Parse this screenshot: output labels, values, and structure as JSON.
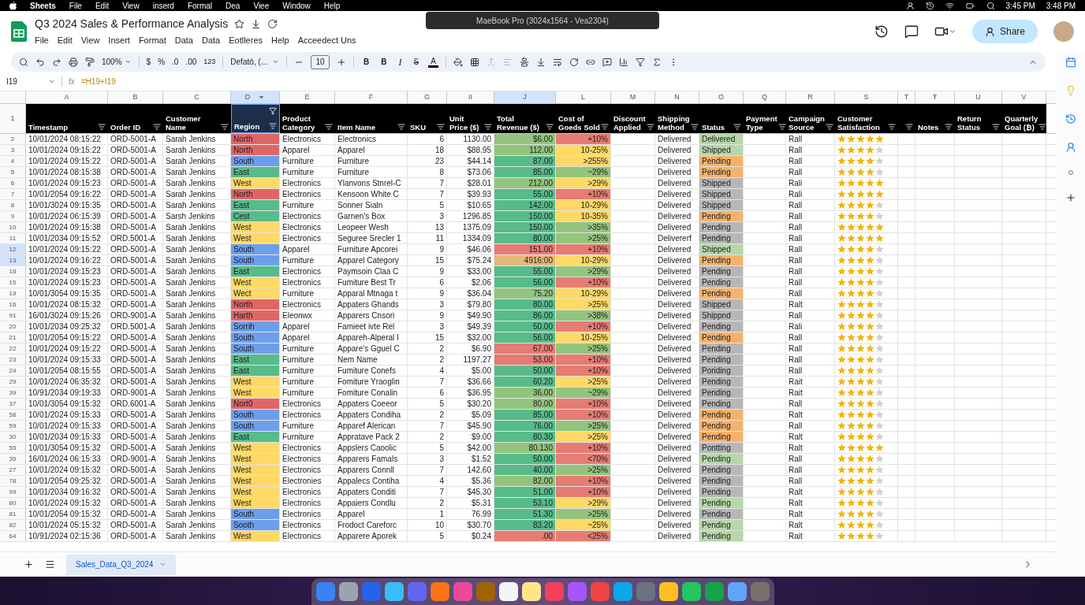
{
  "menubar": {
    "app": "Sheets",
    "items": [
      "File",
      "Edit",
      "View",
      "inserd",
      "Formal",
      "Dea",
      "Viee",
      "Window",
      "Help"
    ],
    "times": [
      "3:45 PM",
      "3:48 PM"
    ]
  },
  "tooltip": "MaeBook Pro (3024x1564 - Vea2304)",
  "doc": {
    "title": "Q3 2024 Sales & Performance Analysis",
    "menus": [
      "File",
      "Edit",
      "View",
      "Insert",
      "Format",
      "Data",
      "Data",
      "Eotlleres",
      "Help",
      "Acceedect Uns"
    ],
    "share": "Share"
  },
  "toolbar": {
    "zoom": "100%",
    "currency": "$",
    "percent": "%",
    "decrease_decimal": ".0",
    "increase_decimal": ".00",
    "number_format": "123",
    "font": "Defató, (...",
    "font_size": "10",
    "bold": "B",
    "bold_2": "B",
    "italic": "I",
    "strikethrough": "S",
    "text_color": "A"
  },
  "formula_bar": {
    "cell": "I19",
    "fx_label": "fx",
    "formula": "=H19+I19"
  },
  "header_row_number": "1",
  "columns": [
    {
      "letter": "A",
      "header": "Timestamp",
      "selected": false,
      "filter_active": false
    },
    {
      "letter": "B",
      "header": "Order ID",
      "selected": false,
      "filter_active": false
    },
    {
      "letter": "C",
      "header": "Customer Name",
      "selected": false,
      "filter_active": false
    },
    {
      "letter": "D",
      "header": "Region",
      "selected": true,
      "filter_active": true
    },
    {
      "letter": "E",
      "header": "Product Category",
      "selected": false,
      "filter_active": false
    },
    {
      "letter": "F",
      "header": "Item Name",
      "selected": false,
      "filter_active": false
    },
    {
      "letter": "G",
      "header": "SKU",
      "selected": false,
      "filter_active": false
    },
    {
      "letter": "II",
      "header": "Unit Price ($)",
      "selected": false,
      "filter_active": false
    },
    {
      "letter": "J",
      "header": "Total Revenue ($)",
      "selected": true,
      "filter_active": false
    },
    {
      "letter": "L",
      "header": "Cost of Goeds Sold",
      "selected": false,
      "filter_active": false
    },
    {
      "letter": "M",
      "header": "Discount Applied",
      "selected": false,
      "filter_active": false
    },
    {
      "letter": "N",
      "header": "Shipping Method",
      "selected": false,
      "filter_active": false
    },
    {
      "letter": "O",
      "header": "Status",
      "selected": false,
      "filter_active": false
    },
    {
      "letter": "Q",
      "header": "Payment Type",
      "selected": false,
      "filter_active": false
    },
    {
      "letter": "R",
      "header": "Campaign Source",
      "selected": false,
      "filter_active": false
    },
    {
      "letter": "S",
      "header": "Customer Satisfaction",
      "selected": false,
      "filter_active": false
    },
    {
      "letter": "T",
      "selected": false,
      "filter_active": false
    },
    {
      "letter": "Ŧ",
      "header": "Notes",
      "selected": false,
      "filter_active": false
    },
    {
      "letter": "U",
      "header": "Return Status",
      "selected": false,
      "filter_active": false
    },
    {
      "letter": "V",
      "header": "Quarterly Goal (₿)",
      "selected": false,
      "filter_active": false
    }
  ],
  "rows": [
    {
      "num": "2",
      "selected": false,
      "timestamp": "10/01/2024 08:15:22",
      "order_id": "ORD-5001-A",
      "customer": "Sarah Jenkins",
      "region": {
        "text": "North",
        "color": "#e06666"
      },
      "category": "Electronics",
      "item": "Electronics",
      "sku": "6",
      "price": "1130.00",
      "revenue": {
        "text": "$6.00",
        "color": "#93c47d"
      },
      "cost": {
        "text": "+10%",
        "color": "#e67c73"
      },
      "shipping": "Delivered",
      "status": {
        "text": "Delivered",
        "color": "#b6d7a8"
      },
      "campaign": "Rall",
      "stars": 5
    },
    {
      "num": "3",
      "selected": false,
      "timestamp": "10/01/2024 09:15:22",
      "order_id": "ORD-5001-A",
      "customer": "Sarah Jenkins",
      "region": {
        "text": "North",
        "color": "#e06666"
      },
      "category": "Apparel",
      "item": "Apparel",
      "sku": "18",
      "price": "$88.95",
      "revenue": {
        "text": "112.00",
        "color": "#93c47d"
      },
      "cost": {
        "text": "10-25%",
        "color": "#ffd966"
      },
      "shipping": "Delivered",
      "status": {
        "text": "Shipped",
        "color": "#b6d7a8"
      },
      "campaign": "Rall",
      "stars": 4
    },
    {
      "num": "4",
      "selected": false,
      "timestamp": "10/01/2024 09:15:22",
      "order_id": "ORD-5001-A",
      "customer": "Sarah Jenkins",
      "region": {
        "text": "South",
        "color": "#6d9eeb"
      },
      "category": "Furniture",
      "item": "Furniture",
      "sku": "23",
      "price": "$44.14",
      "revenue": {
        "text": "87.00",
        "color": "#57bb8a"
      },
      "cost": {
        "text": ">255%",
        "color": "#ffd966"
      },
      "shipping": "Delivered",
      "status": {
        "text": "Pending",
        "color": "#f6b26b"
      },
      "campaign": "Rall",
      "stars": 4
    },
    {
      "num": "5",
      "selected": false,
      "timestamp": "10/01/2024 08:15:38",
      "order_id": "ORD-5001-A",
      "customer": "Sarah Jenkins",
      "region": {
        "text": "East",
        "color": "#57bb8a"
      },
      "category": "Furniture",
      "item": "Furniture",
      "sku": "8",
      "price": "$73.06",
      "revenue": {
        "text": "85.00",
        "color": "#57bb8a"
      },
      "cost": {
        "text": "~29%",
        "color": "#93c47d"
      },
      "shipping": "Delivered",
      "status": {
        "text": "Pending",
        "color": "#f6b26b"
      },
      "campaign": "Rall",
      "stars": 4
    },
    {
      "num": "6",
      "selected": false,
      "timestamp": "10/01/2024 09:15:23",
      "order_id": "ORD-5001-A",
      "customer": "Sarah Jenkins",
      "region": {
        "text": "West",
        "color": "#ffd966"
      },
      "category": "Electronics",
      "item": "Ylanvons Stnrel-C",
      "sku": "7",
      "price": "$28.01",
      "revenue": {
        "text": "212.00",
        "color": "#93c47d"
      },
      "cost": {
        "text": ">29%",
        "color": "#ffd966"
      },
      "shipping": "Delivered",
      "status": {
        "text": "Shipped",
        "color": "#b7b7b7"
      },
      "campaign": "Rali",
      "stars": 5
    },
    {
      "num": "7",
      "selected": false,
      "timestamp": "10/01/2054 09:16:22",
      "order_id": "ORD-5001-A",
      "customer": "Sarah Jenkins",
      "region": {
        "text": "North",
        "color": "#e06666"
      },
      "category": "Electronics",
      "item": "Kensoon White C",
      "sku": "7",
      "price": "$39.93",
      "revenue": {
        "text": "55.00",
        "color": "#57bb8a"
      },
      "cost": {
        "text": "+10%",
        "color": "#e67c73"
      },
      "shipping": "Delivered",
      "status": {
        "text": "Shipped",
        "color": "#b7b7b7"
      },
      "campaign": "Rali",
      "stars": 5
    },
    {
      "num": "8",
      "selected": false,
      "timestamp": "10/01/3024 09:15:35",
      "order_id": "ORD-5001-A",
      "customer": "Sarah Jenkins",
      "region": {
        "text": "East",
        "color": "#57bb8a"
      },
      "category": "Furniture",
      "item": "Sonner Sialn",
      "sku": "5",
      "price": "$10.65",
      "revenue": {
        "text": "142.00",
        "color": "#57bb8a"
      },
      "cost": {
        "text": "10-29%",
        "color": "#ffd966"
      },
      "shipping": "Delivered",
      "status": {
        "text": "Shipped",
        "color": "#b7b7b7"
      },
      "campaign": "Rall",
      "stars": 4
    },
    {
      "num": "9",
      "selected": false,
      "timestamp": "10/01/2024 06:15:39",
      "order_id": "ORD-5001-A",
      "customer": "Sarsh Jenkins",
      "region": {
        "text": "Cest",
        "color": "#57bb8a"
      },
      "category": "Electronics",
      "item": "Garnen's Box",
      "sku": "3",
      "price": "1296.85",
      "revenue": {
        "text": "150.00",
        "color": "#57bb8a"
      },
      "cost": {
        "text": "10-35%",
        "color": "#ffd966"
      },
      "shipping": "Delivered",
      "status": {
        "text": "Pending",
        "color": "#f6b26b"
      },
      "campaign": "Rall",
      "stars": 4
    },
    {
      "num": "10",
      "selected": false,
      "timestamp": "10/01/2024 09:15:38",
      "order_id": "ORD-5001-A",
      "customer": "Sarah Jenkins",
      "region": {
        "text": "West",
        "color": "#ffd966"
      },
      "category": "Electronics",
      "item": "Leopeer Wesh",
      "sku": "13",
      "price": "1375.09",
      "revenue": {
        "text": "150.00",
        "color": "#57bb8a"
      },
      "cost": {
        "text": ">35%",
        "color": "#93c47d"
      },
      "shipping": "Delivered",
      "status": {
        "text": "Pending",
        "color": "#b7b7b7"
      },
      "campaign": "Rall",
      "stars": 5
    },
    {
      "num": "11",
      "selected": false,
      "timestamp": "10/01/2034 09:15:52",
      "order_id": "ORD.5001-A",
      "customer": "Sarah Jenkins",
      "region": {
        "text": "West",
        "color": "#ffd966"
      },
      "category": "Electronics",
      "item": "Seguree Srecler 1",
      "sku": "11",
      "price": "1334.09",
      "revenue": {
        "text": "80.00",
        "color": "#57bb8a"
      },
      "cost": {
        "text": ">25%",
        "color": "#93c47d"
      },
      "shipping": "Delivererf",
      "status": {
        "text": "Pending",
        "color": "#b7b7b7"
      },
      "campaign": "Rall",
      "stars": 5
    },
    {
      "num": "12",
      "selected": true,
      "timestamp": "10/01/2024 09:15:22",
      "order_id": "ORD-5001-A",
      "customer": "Sarah Jenkins",
      "region": {
        "text": "South",
        "color": "#6d9eeb"
      },
      "category": "Apparel",
      "item": "Furniture Apcorei",
      "sku": "9",
      "price": "$46.06",
      "revenue": {
        "text": "151.00",
        "color": "#e67c73"
      },
      "cost": {
        "text": "+10%",
        "color": "#e67c73"
      },
      "shipping": "Delivered",
      "status": {
        "text": "Shipped",
        "color": "#b6d7a8"
      },
      "campaign": "Rall",
      "stars": 4
    },
    {
      "num": "13",
      "selected": true,
      "timestamp": "10/01/2024 09:16:22",
      "order_id": "ORD-5001-A",
      "customer": "Sarah Jenkins",
      "region": {
        "text": "South",
        "color": "#6d9eeb"
      },
      "category": "Furniture",
      "item": "Apparel Category",
      "sku": "15",
      "price": "$75.24",
      "revenue": {
        "text": "4916:00",
        "color": "#e6b87a"
      },
      "cost": {
        "text": "10-29%",
        "color": "#ffd966"
      },
      "shipping": "Delivered",
      "status": {
        "text": "Pending",
        "color": "#f6b26b"
      },
      "campaign": "Rall",
      "stars": 4
    },
    {
      "num": "18",
      "selected": false,
      "timestamp": "10/01/2024 09:15:23",
      "order_id": "ORD-5001-A",
      "customer": "Sarah Jenkins",
      "region": {
        "text": "East",
        "color": "#57bb8a"
      },
      "category": "Electronics",
      "item": "Paymsoin Claa C",
      "sku": "9",
      "price": "$33.00",
      "revenue": {
        "text": "55.00",
        "color": "#57bb8a"
      },
      "cost": {
        "text": ">29%",
        "color": "#93c47d"
      },
      "shipping": "Delivered",
      "status": {
        "text": "Pending",
        "color": "#b7b7b7"
      },
      "campaign": "Rall",
      "stars": 4
    },
    {
      "num": "15",
      "selected": false,
      "timestamp": "10/01/2024 09:15:23",
      "order_id": "ORD-5001-A",
      "customer": "Sarah Jenkins",
      "region": {
        "text": "West",
        "color": "#ffd966"
      },
      "category": "Electronics",
      "item": "Fumiture Best Tr",
      "sku": "6",
      "price": "$2.06",
      "revenue": {
        "text": "56.00",
        "color": "#57bb8a"
      },
      "cost": {
        "text": "+10%",
        "color": "#e67c73"
      },
      "shipping": "Delivered",
      "status": {
        "text": "Pending",
        "color": "#b7b7b7"
      },
      "campaign": "Rall",
      "stars": 4
    },
    {
      "num": "19",
      "selected": false,
      "timestamp": "10/01/3054 09:15:35",
      "order_id": "ORD-5001-A",
      "customer": "Sarah Jenkins",
      "region": {
        "text": "Wect",
        "color": "#ffd966"
      },
      "category": "Furniture",
      "item": "Apparal Mtnaga t",
      "sku": "9",
      "price": "$36.04",
      "revenue": {
        "text": "75.20",
        "color": "#93c47d"
      },
      "cost": {
        "text": "10-29%",
        "color": "#ffd966"
      },
      "shipping": "Delivered",
      "status": {
        "text": "Pending",
        "color": "#f6b26b"
      },
      "campaign": "Rall",
      "stars": 4
    },
    {
      "num": "16",
      "selected": false,
      "timestamp": "10/01/2024 08:15:32",
      "order_id": "ORD-5001-A",
      "customer": "Sarah Jenkins",
      "region": {
        "text": "North",
        "color": "#e06666"
      },
      "category": "Electronics",
      "item": "Appaters Ghands",
      "sku": "3",
      "price": "$79.80",
      "revenue": {
        "text": "80.00",
        "color": "#57bb8a"
      },
      "cost": {
        "text": ">25%",
        "color": "#ffd966"
      },
      "shipping": "Delivered",
      "status": {
        "text": "Shipped",
        "color": "#b7b7b7"
      },
      "campaign": "Ralt",
      "stars": 4
    },
    {
      "num": "91",
      "selected": false,
      "timestamp": "16/01/3024 09:15:26",
      "order_id": "ORD-9001-A",
      "customer": "Sarah Jenkins",
      "region": {
        "text": "Harth",
        "color": "#e06666"
      },
      "category": "Eleonwx",
      "item": "Apparers Cnsori",
      "sku": "9",
      "price": "$49.90",
      "revenue": {
        "text": "86.00",
        "color": "#57bb8a"
      },
      "cost": {
        "text": ">38%",
        "color": "#93c47d"
      },
      "shipping": "Delivered",
      "status": {
        "text": "Shippnd",
        "color": "#b7b7b7"
      },
      "campaign": "Rall",
      "stars": 4
    },
    {
      "num": "20",
      "selected": false,
      "timestamp": "10/01/2034 09:25:32",
      "order_id": "ORD.5001-A",
      "customer": "Sarah Jenkins",
      "region": {
        "text": "Sorrih",
        "color": "#6d9eeb"
      },
      "category": "Apparel",
      "item": "Famieet ivte Rel",
      "sku": "3",
      "price": "$49.39",
      "revenue": {
        "text": "50.00",
        "color": "#57bb8a"
      },
      "cost": {
        "text": "+10%",
        "color": "#e67c73"
      },
      "shipping": "Delivered",
      "status": {
        "text": "Pending",
        "color": "#b7b7b7"
      },
      "campaign": "Rali",
      "stars": 4
    },
    {
      "num": "21",
      "selected": false,
      "timestamp": "10/01/2054 09:15:22",
      "order_id": "ORD-5001-A",
      "customer": "Sarah Jenkins",
      "region": {
        "text": "South",
        "color": "#6d9eeb"
      },
      "category": "Apparel",
      "item": "Appareh-Alperal I",
      "sku": "15",
      "price": "$32.00",
      "revenue": {
        "text": "56.00",
        "color": "#57bb8a"
      },
      "cost": {
        "text": "10-25%",
        "color": "#ffd966"
      },
      "shipping": "Delivered",
      "status": {
        "text": "Pending",
        "color": "#f6b26b"
      },
      "campaign": "Rall",
      "stars": 4
    },
    {
      "num": "22",
      "selected": false,
      "timestamp": "10/01/2024 09:15:22",
      "order_id": "ORD-5001-A",
      "customer": "Sarah Jenkins",
      "region": {
        "text": "South",
        "color": "#6d9eeb"
      },
      "category": "Furniture",
      "item": "Appare's Gguel C",
      "sku": "2",
      "price": "$6.90",
      "revenue": {
        "text": "67.00",
        "color": "#e67c73"
      },
      "cost": {
        "text": ">25%",
        "color": "#93c47d"
      },
      "shipping": "Delivered",
      "status": {
        "text": "Pending",
        "color": "#b7b7b7"
      },
      "campaign": "Rall",
      "stars": 4
    },
    {
      "num": "23",
      "selected": false,
      "timestamp": "10/01/2024 09:15:33",
      "order_id": "ORD-5001-A",
      "customer": "Sarah Jenkins",
      "region": {
        "text": "East",
        "color": "#57bb8a"
      },
      "category": "Furniture",
      "item": "Nem Name",
      "sku": "2",
      "price": "1197.27",
      "revenue": {
        "text": "53.00",
        "color": "#e67c73"
      },
      "cost": {
        "text": "+10%",
        "color": "#e67c73"
      },
      "shipping": "Delivered",
      "status": {
        "text": "Pending",
        "color": "#b7b7b7"
      },
      "campaign": "Rall",
      "stars": 4
    },
    {
      "num": "24",
      "selected": false,
      "timestamp": "10/01/2054 08:15:55",
      "order_id": "ORD-5001-A",
      "customer": "Sarah Jenkins",
      "region": {
        "text": "East",
        "color": "#57bb8a"
      },
      "category": "Furniture",
      "item": "Fumiture Conefs",
      "sku": "4",
      "price": "$5.00",
      "revenue": {
        "text": "50.00",
        "color": "#57bb8a"
      },
      "cost": {
        "text": "+10%",
        "color": "#e67c73"
      },
      "shipping": "Delivered",
      "status": {
        "text": "Poriding",
        "color": "#b7b7b7"
      },
      "campaign": "Rall",
      "stars": 4
    },
    {
      "num": "29",
      "selected": false,
      "timestamp": "10/01/2024 06:35:32",
      "order_id": "ORD-5001-A",
      "customer": "Sarah Jenkins",
      "region": {
        "text": "West",
        "color": "#ffd966"
      },
      "category": "Furniture",
      "item": "Fomiture Yraoglin",
      "sku": "7",
      "price": "$36.66",
      "revenue": {
        "text": "60.20",
        "color": "#57bb8a"
      },
      "cost": {
        "text": ">25%",
        "color": "#ffd966"
      },
      "shipping": "Delivered",
      "status": {
        "text": "Pending",
        "color": "#b7b7b7"
      },
      "campaign": "Rait",
      "stars": 4
    },
    {
      "num": "39",
      "selected": false,
      "timestamp": "10/91/2034 09:19:33",
      "order_id": "ORD-9001-A",
      "customer": "Sarah Jenkins",
      "region": {
        "text": "West",
        "color": "#ffd966"
      },
      "category": "Furniture",
      "item": "Fomiture Conalin",
      "sku": "6",
      "price": "$36.95",
      "revenue": {
        "text": "36.00",
        "color": "#93c47d"
      },
      "cost": {
        "text": "~29%",
        "color": "#93c47d"
      },
      "shipping": "Delivered",
      "status": {
        "text": "Pending",
        "color": "#b7b7b7"
      },
      "campaign": "Rait",
      "stars": 4
    },
    {
      "num": "37",
      "selected": false,
      "timestamp": "10/01/3054 09:15:32",
      "order_id": "ORD.6001-A",
      "customer": "Sarah Jenkins",
      "region": {
        "text": "Nort0",
        "color": "#e06666"
      },
      "category": "Electronics",
      "item": "Appaters Coeeor",
      "sku": "5",
      "price": "$30.20",
      "revenue": {
        "text": "80.00",
        "color": "#93c47d"
      },
      "cost": {
        "text": "+10%",
        "color": "#e67c73"
      },
      "shipping": "Delivered",
      "status": {
        "text": "Pending",
        "color": "#b7b7b7"
      },
      "campaign": "Rall",
      "stars": 4
    },
    {
      "num": "58",
      "selected": false,
      "timestamp": "10/01/2024 09:15:33",
      "order_id": "ORD-5001-A",
      "customer": "Sarah Jenkins",
      "region": {
        "text": "South",
        "color": "#6d9eeb"
      },
      "category": "Electronics",
      "item": "Appaters Condiha",
      "sku": "2",
      "price": "$5.09",
      "revenue": {
        "text": "85.00",
        "color": "#57bb8a"
      },
      "cost": {
        "text": "+10%",
        "color": "#e67c73"
      },
      "shipping": "Delivered",
      "status": {
        "text": "Pending",
        "color": "#f6b26b"
      },
      "campaign": "Ralt",
      "stars": 4
    },
    {
      "num": "59",
      "selected": false,
      "timestamp": "10/01/2024 09:15:33",
      "order_id": "ORD-5001-A",
      "customer": "Sarah Jenkins",
      "region": {
        "text": "South",
        "color": "#6d9eeb"
      },
      "category": "Furniture",
      "item": "Apparef Alerican",
      "sku": "7",
      "price": "$45.90",
      "revenue": {
        "text": "76.00",
        "color": "#57bb8a"
      },
      "cost": {
        "text": ">25%",
        "color": "#93c47d"
      },
      "shipping": "Delivered",
      "status": {
        "text": "Pending",
        "color": "#f6b26b"
      },
      "campaign": "Rall",
      "stars": 4
    },
    {
      "num": "30",
      "selected": false,
      "timestamp": "10/01/2034 09:15:33",
      "order_id": "ORD-5001-A",
      "customer": "Sarah Jenkins",
      "region": {
        "text": "East",
        "color": "#57bb8a"
      },
      "category": "Furniture",
      "item": "Appratave Pack 2",
      "sku": "2",
      "price": "$9.00",
      "revenue": {
        "text": "80.30",
        "color": "#57bb8a"
      },
      "cost": {
        "text": ">25%",
        "color": "#ffd966"
      },
      "shipping": "Delivered",
      "status": {
        "text": "Pending",
        "color": "#f6b26b"
      },
      "campaign": "Ralt",
      "stars": 4
    },
    {
      "num": "55",
      "selected": false,
      "timestamp": "10/01/3054 09:15:32",
      "order_id": "ORD-5001-A",
      "customer": "Sarah Jenkins",
      "region": {
        "text": "West",
        "color": "#ffd966"
      },
      "category": "Electronics",
      "item": "Appslers Caoolic",
      "sku": "5",
      "price": "$42.00",
      "revenue": {
        "text": "80.130",
        "color": "#93c47d"
      },
      "cost": {
        "text": "+10%",
        "color": "#e67c73"
      },
      "shipping": "Delivered",
      "status": {
        "text": "Pontting",
        "color": "#b7b7b7"
      },
      "campaign": "Ralt",
      "stars": 5
    },
    {
      "num": "35",
      "selected": false,
      "timestamp": "16/01/2024 06:15:33",
      "order_id": "ORD-9001-A",
      "customer": "Sarah Jenkins",
      "region": {
        "text": "West",
        "color": "#ffd966"
      },
      "category": "Electronics",
      "item": "Apparers Famals",
      "sku": "3",
      "price": "$1.52",
      "revenue": {
        "text": "50.00",
        "color": "#57bb8a"
      },
      "cost": {
        "text": "<70%",
        "color": "#e67c73"
      },
      "shipping": "Delivered",
      "status": {
        "text": "Pending",
        "color": "#b6d7a8"
      },
      "campaign": "Rall",
      "stars": 4
    },
    {
      "num": "27",
      "selected": false,
      "timestamp": "10/01/2024 09:15:32",
      "order_id": "ORD-5001-A",
      "customer": "Sarah Jenkins",
      "region": {
        "text": "West",
        "color": "#ffd966"
      },
      "category": "Electronics",
      "item": "Apparers Connll",
      "sku": "7",
      "price": "142.60",
      "revenue": {
        "text": "40.00",
        "color": "#57bb8a"
      },
      "cost": {
        "text": ">25%",
        "color": "#93c47d"
      },
      "shipping": "Delivered",
      "status": {
        "text": "Pending",
        "color": "#b7b7b7"
      },
      "campaign": "Rall",
      "stars": 4
    },
    {
      "num": "78",
      "selected": false,
      "timestamp": "10/01/2054 09:25:32",
      "order_id": "ORD-5001-A",
      "customer": "Sarah Jenkins",
      "region": {
        "text": "West",
        "color": "#ffd966"
      },
      "category": "Electronies",
      "item": "Appalecs Contiha",
      "sku": "4",
      "price": "$5.36",
      "revenue": {
        "text": "82.00",
        "color": "#93c47d"
      },
      "cost": {
        "text": "+10%",
        "color": "#e67c73"
      },
      "shipping": "Delivered",
      "status": {
        "text": "Pending",
        "color": "#b7b7b7"
      },
      "campaign": "Rall",
      "stars": 4
    },
    {
      "num": "99",
      "selected": false,
      "timestamp": "10/01/2034 09:16:32",
      "order_id": "ORD-5001-A",
      "customer": "Sarah Jenkins",
      "region": {
        "text": "West",
        "color": "#ffd966"
      },
      "category": "Electronics",
      "item": "Appaters Conditi",
      "sku": "7",
      "price": "$45.30",
      "revenue": {
        "text": "51.00",
        "color": "#57bb8a"
      },
      "cost": {
        "text": "+10%",
        "color": "#e67c73"
      },
      "shipping": "Delivered",
      "status": {
        "text": "Pending",
        "color": "#b7b7b7"
      },
      "campaign": "Ralt",
      "stars": 4
    },
    {
      "num": "80",
      "selected": false,
      "timestamp": "10/01/2024 09:15:32",
      "order_id": "ORD-5001-A",
      "customer": "Sarah Jenkins",
      "region": {
        "text": "West",
        "color": "#ffd966"
      },
      "category": "Electronics",
      "item": "Appaiers Condlu",
      "sku": "2",
      "price": "$5.31",
      "revenue": {
        "text": "53.10",
        "color": "#57bb8a"
      },
      "cost": {
        "text": ">29%",
        "color": "#ffd966"
      },
      "shipping": "Delivered",
      "status": {
        "text": "Pending",
        "color": "#b6d7a8"
      },
      "campaign": "Ralt",
      "stars": 4
    },
    {
      "num": "81",
      "selected": false,
      "timestamp": "10/01/2054 09:15:32",
      "order_id": "ORD-5001-A",
      "customer": "Sarah Jenkins",
      "region": {
        "text": "South",
        "color": "#6d9eeb"
      },
      "category": "Electronics",
      "item": "Apparel",
      "sku": "1",
      "price": "76.99",
      "revenue": {
        "text": "51.30",
        "color": "#57bb8a"
      },
      "cost": {
        "text": ">25%",
        "color": "#93c47d"
      },
      "shipping": "Delivered",
      "status": {
        "text": "Pending",
        "color": "#b7b7b7"
      },
      "campaign": "Ralt",
      "stars": 4
    },
    {
      "num": "82",
      "selected": false,
      "timestamp": "10/01/2024 05:15:32",
      "order_id": "ORD-5001-A",
      "customer": "Sarah Jenkins",
      "region": {
        "text": "Sooth",
        "color": "#6d9eeb"
      },
      "category": "Electronics",
      "item": "Frodoct Careforc",
      "sku": "10",
      "price": "$30.70",
      "revenue": {
        "text": "83.20",
        "color": "#57bb8a"
      },
      "cost": {
        "text": "~25%",
        "color": "#ffd966"
      },
      "shipping": "Delivered",
      "status": {
        "text": "Pending",
        "color": "#b6d7a8"
      },
      "campaign": "Ralt",
      "stars": 4
    },
    {
      "num": "64",
      "selected": false,
      "timestamp": "10/91/2024 02:15:36",
      "order_id": "ORD-5001-A",
      "customer": "Sarah Jenkins",
      "region": {
        "text": "West",
        "color": "#ffd966"
      },
      "category": "Electronics",
      "item": "Apparere Aporek",
      "sku": "5",
      "price": "$0.24",
      "revenue": {
        "text": ".00",
        "color": "#e67c73"
      },
      "cost": {
        "text": "<25%",
        "color": "#e67c73"
      },
      "shipping": "Delivered",
      "status": {
        "text": "Pending",
        "color": "#b6d7a8"
      },
      "campaign": "Rait",
      "stars": 4
    }
  ],
  "sheet_tab": "Sales_Data_Q3_2024"
}
